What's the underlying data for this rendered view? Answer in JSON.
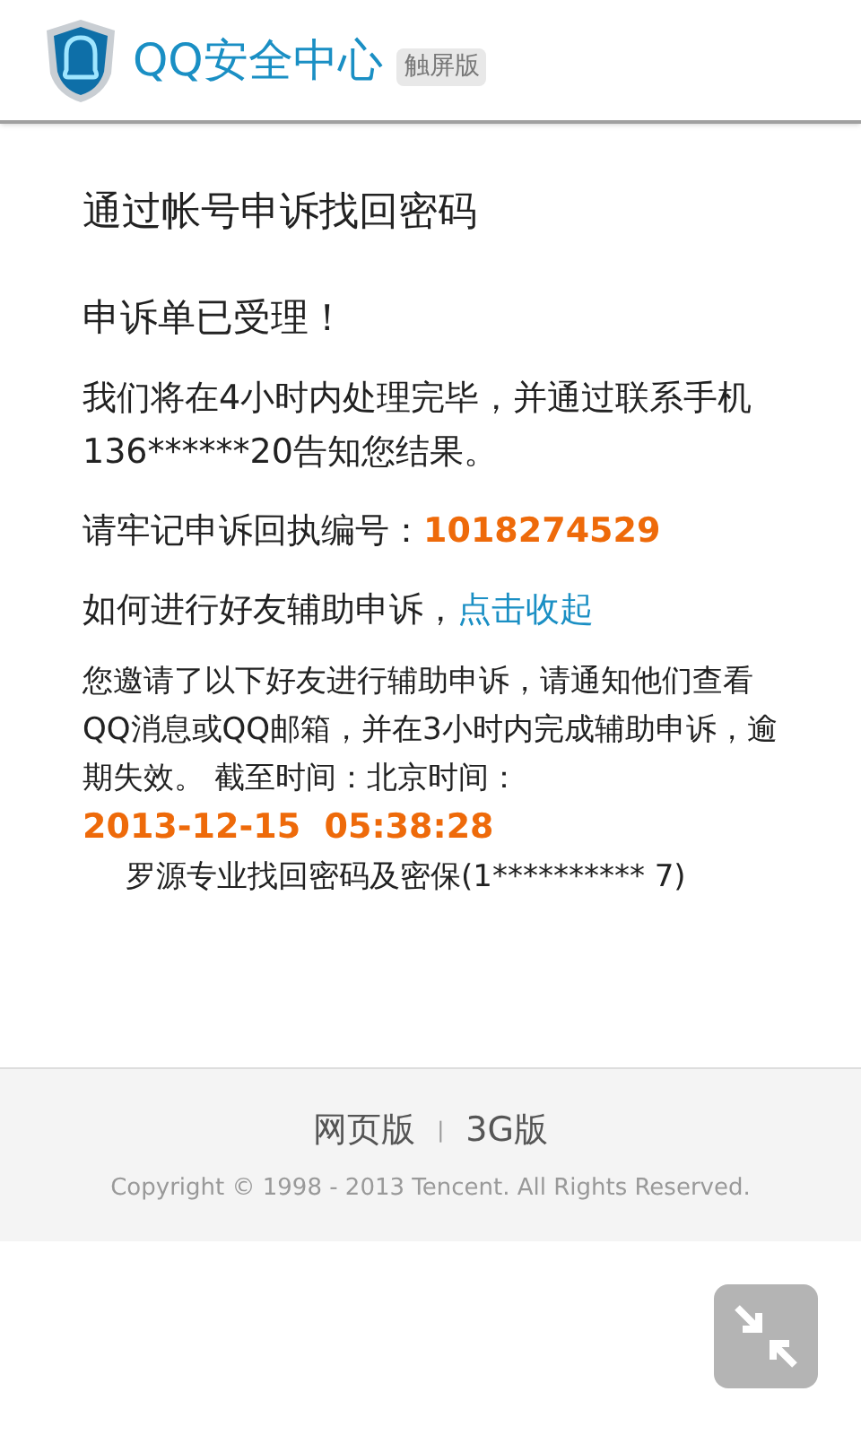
{
  "header": {
    "title": "QQ安全中心",
    "badge": "触屏版"
  },
  "page_title": "通过帐号申诉找回密码",
  "status": "申诉单已受理！",
  "message": "我们将在4小时内处理完毕，并通过联系手机136******20告知您结果。",
  "receipt": {
    "label": "请牢记申诉回执编号：",
    "number": "1018274529"
  },
  "friend_help": {
    "label": "如何进行好友辅助申诉，",
    "link": "点击收起"
  },
  "notice": {
    "text": "您邀请了以下好友进行辅助申诉，请通知他们查看QQ消息或QQ邮箱，并在3小时内完成辅助申诉，逾期失效。 截至时间：北京时间：",
    "time": "2013-12-15  05:38:28"
  },
  "friends": [
    "罗源专业找回密码及密保(1********** 7)"
  ],
  "footer": {
    "links": [
      "网页版",
      "3G版"
    ],
    "separator": "|",
    "copyright": "Copyright © 1998 - 2013 Tencent. All Rights Reserved."
  }
}
